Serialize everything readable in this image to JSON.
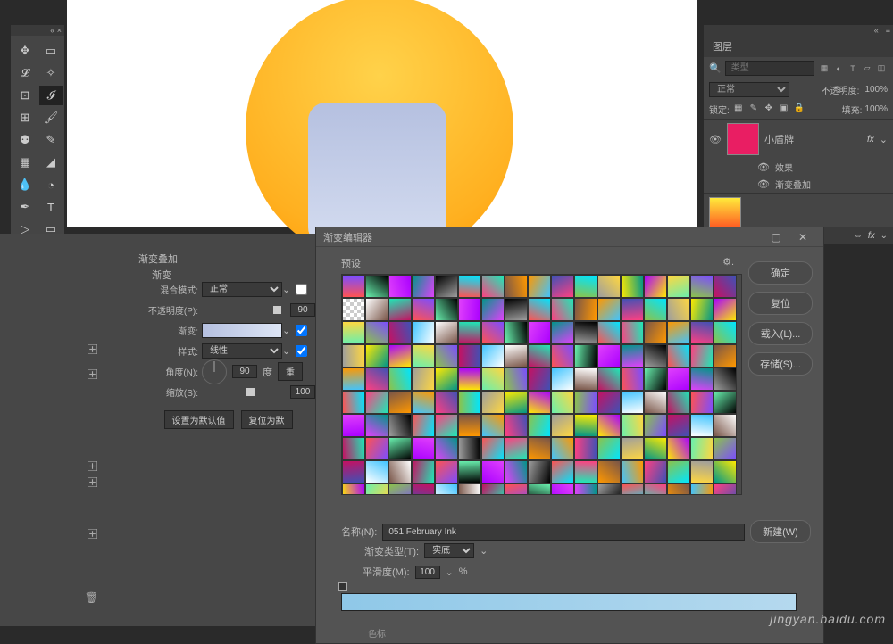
{
  "layers_panel": {
    "tab": "图层",
    "search_placeholder": "类型",
    "blend_mode": "正常",
    "opacity_label": "不透明度:",
    "opacity_value": "100%",
    "lock_label": "锁定:",
    "fill_label": "填充:",
    "fill_value": "100%",
    "layer1": "小盾牌",
    "fx_label": "fx",
    "effects_label": "效果",
    "effect_item": "渐变叠加"
  },
  "style": {
    "title": "渐变叠加",
    "sub": "渐变",
    "blend_label": "混合模式:",
    "blend_value": "正常",
    "opacity_label": "不透明度(P):",
    "opacity_value": "90",
    "gradient_label": "渐变:",
    "style_label": "样式:",
    "style_value": "线性",
    "angle_label": "角度(N):",
    "angle_value": "90",
    "angle_unit": "度",
    "reset_angle": "重",
    "scale_label": "缩放(S):",
    "scale_value": "100",
    "set_default": "设置为默认值",
    "reset_default": "复位为默"
  },
  "gradient_editor": {
    "title": "渐变编辑器",
    "presets_label": "预设",
    "ok": "确定",
    "cancel": "复位",
    "load": "载入(L)...",
    "save": "存储(S)...",
    "name_label": "名称(N):",
    "name_value": "051 February Ink",
    "new_btn": "新建(W)",
    "type_label": "渐变类型(T):",
    "type_value": "实底",
    "smooth_label": "平滑度(M):",
    "smooth_value": "100",
    "smooth_unit": "%",
    "color_label": "色标"
  },
  "watermark": "jingyan.baidu.com"
}
